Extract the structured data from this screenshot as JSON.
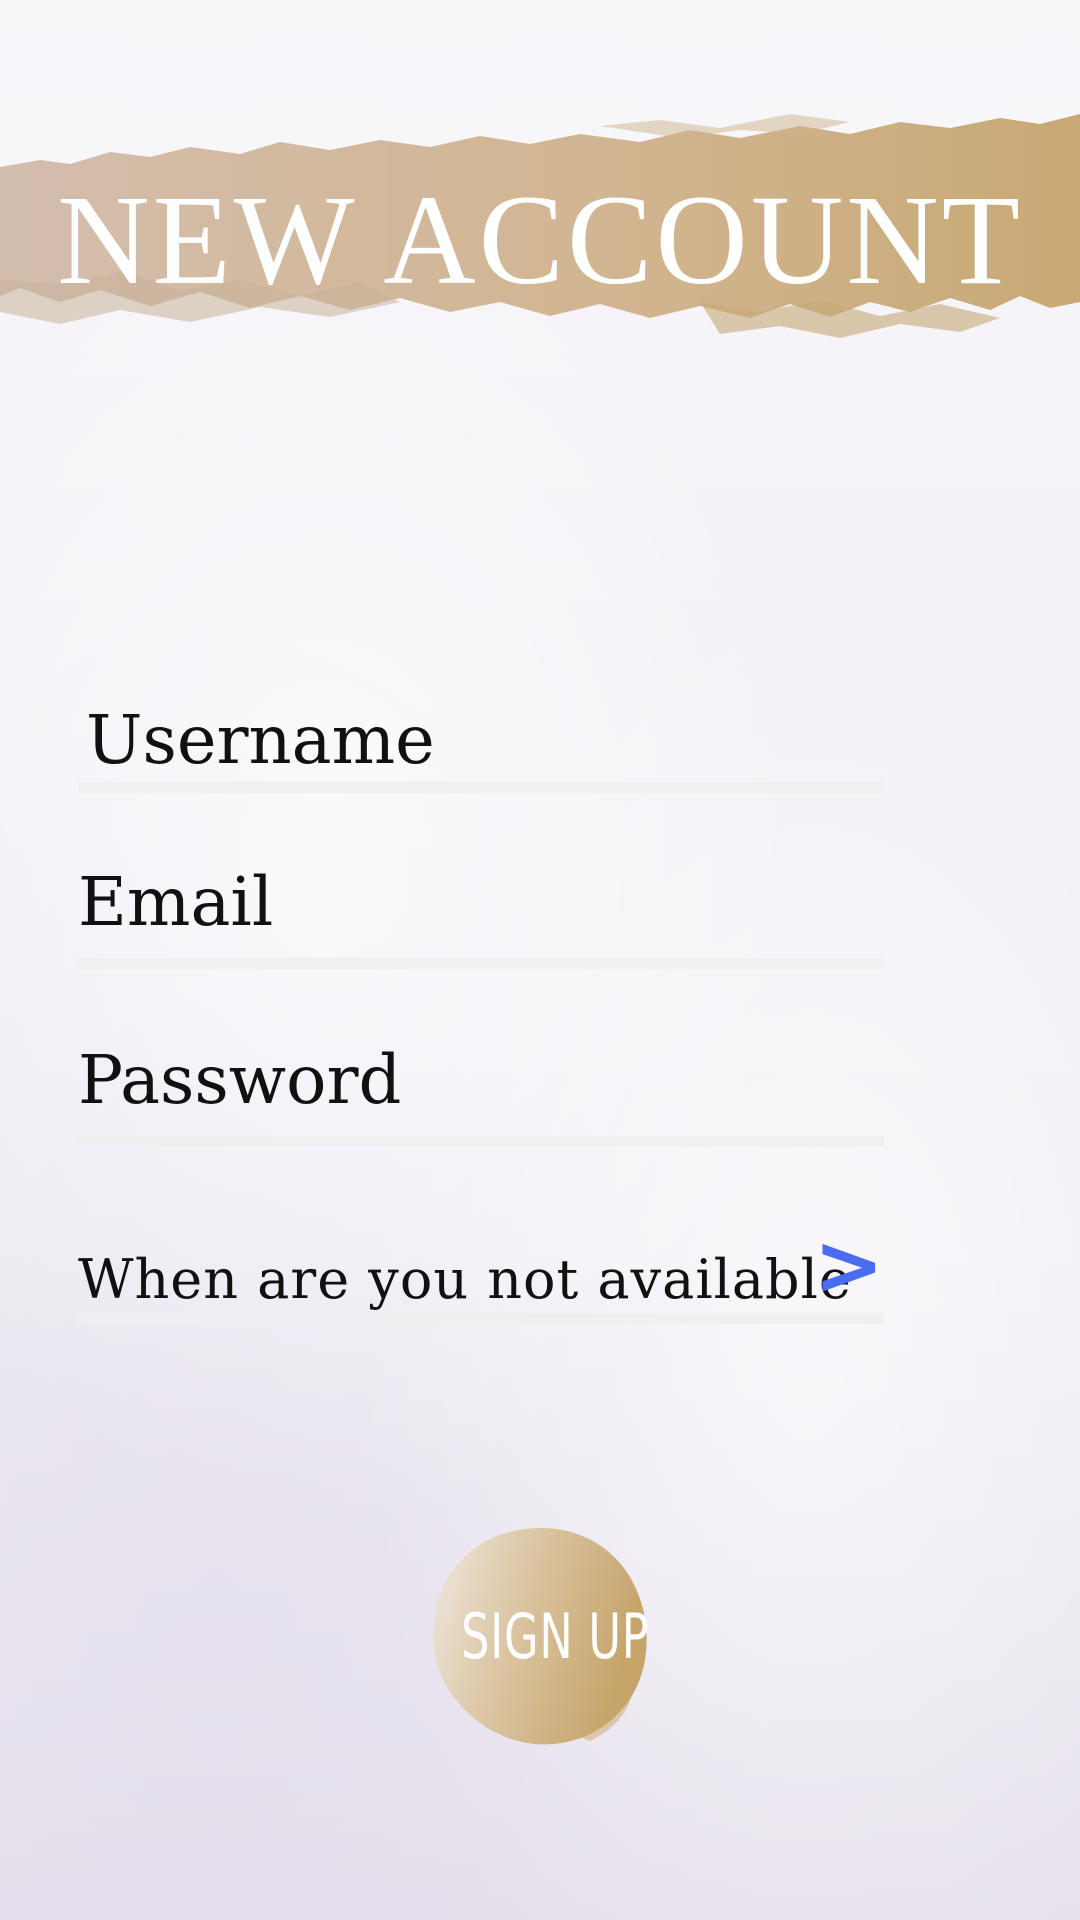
{
  "header": {
    "title": "NEW ACCOUNT"
  },
  "form": {
    "username_label": "Username",
    "email_label": "Email",
    "password_label": "Password",
    "availability_label": "When are you not available",
    "availability_arrow": ">"
  },
  "signup": {
    "label": "SIGN UP"
  },
  "icons": {
    "availability_arrow": "chevron-right-icon"
  },
  "colors": {
    "brush_gold_light": "#d3bdad",
    "brush_gold_dark": "#c8a874",
    "accent_blue": "#4a6cf0",
    "text": "#111111",
    "field_line": "#eeeeee"
  }
}
